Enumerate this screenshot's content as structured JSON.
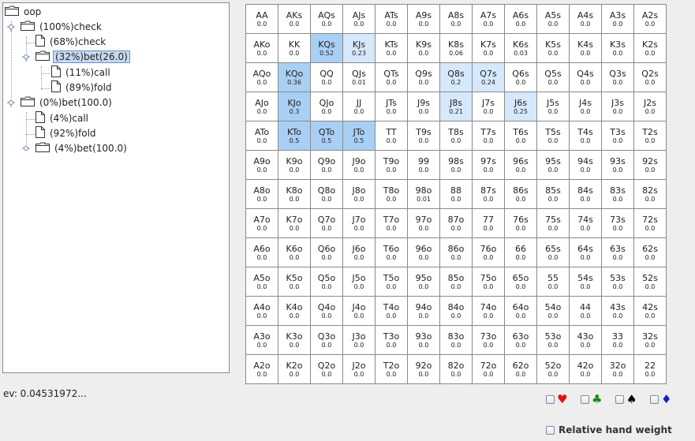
{
  "tree": {
    "root": "oop",
    "nodes": [
      {
        "label": "(100%)check"
      },
      {
        "label": "(68%)check"
      },
      {
        "label": "(32%)bet(26.0)"
      },
      {
        "label": "(11%)call"
      },
      {
        "label": "(89%)fold"
      },
      {
        "label": "(0%)bet(100.0)"
      },
      {
        "label": "(4%)call"
      },
      {
        "label": "(92%)fold"
      },
      {
        "label": "(4%)bet(100.0)"
      }
    ]
  },
  "matrix": {
    "highlight_color": "#a9cff5",
    "light_color": "#d6e8fb",
    "rows": [
      [
        [
          "AA",
          "0.0"
        ],
        [
          "AKs",
          "0.0"
        ],
        [
          "AQs",
          "0.0"
        ],
        [
          "AJs",
          "0.0"
        ],
        [
          "ATs",
          "0.0"
        ],
        [
          "A9s",
          "0.0"
        ],
        [
          "A8s",
          "0.0"
        ],
        [
          "A7s",
          "0.0"
        ],
        [
          "A6s",
          "0.0"
        ],
        [
          "A5s",
          "0.0"
        ],
        [
          "A4s",
          "0.0"
        ],
        [
          "A3s",
          "0.0"
        ],
        [
          "A2s",
          "0.0"
        ]
      ],
      [
        [
          "AKo",
          "0.0"
        ],
        [
          "KK",
          "0.0"
        ],
        [
          "KQs",
          "0.52"
        ],
        [
          "KJs",
          "0.23"
        ],
        [
          "KTs",
          "0.0"
        ],
        [
          "K9s",
          "0.0"
        ],
        [
          "K8s",
          "0.06"
        ],
        [
          "K7s",
          "0.0"
        ],
        [
          "K6s",
          "0.03"
        ],
        [
          "K5s",
          "0.0"
        ],
        [
          "K4s",
          "0.0"
        ],
        [
          "K3s",
          "0.0"
        ],
        [
          "K2s",
          "0.0"
        ]
      ],
      [
        [
          "AQo",
          "0.0"
        ],
        [
          "KQo",
          "0.36"
        ],
        [
          "QQ",
          "0.0"
        ],
        [
          "QJs",
          "0.01"
        ],
        [
          "QTs",
          "0.0"
        ],
        [
          "Q9s",
          "0.0"
        ],
        [
          "Q8s",
          "0.2"
        ],
        [
          "Q7s",
          "0.24"
        ],
        [
          "Q6s",
          "0.0"
        ],
        [
          "Q5s",
          "0.0"
        ],
        [
          "Q4s",
          "0.0"
        ],
        [
          "Q3s",
          "0.0"
        ],
        [
          "Q2s",
          "0.0"
        ]
      ],
      [
        [
          "AJo",
          "0.0"
        ],
        [
          "KJo",
          "0.3"
        ],
        [
          "QJo",
          "0.0"
        ],
        [
          "JJ",
          "0.0"
        ],
        [
          "JTs",
          "0.0"
        ],
        [
          "J9s",
          "0.0"
        ],
        [
          "J8s",
          "0.21"
        ],
        [
          "J7s",
          "0.0"
        ],
        [
          "J6s",
          "0.25"
        ],
        [
          "J5s",
          "0.0"
        ],
        [
          "J4s",
          "0.0"
        ],
        [
          "J3s",
          "0.0"
        ],
        [
          "J2s",
          "0.0"
        ]
      ],
      [
        [
          "ATo",
          "0.0"
        ],
        [
          "KTo",
          "0.5"
        ],
        [
          "QTo",
          "0.5"
        ],
        [
          "JTo",
          "0.5"
        ],
        [
          "TT",
          "0.0"
        ],
        [
          "T9s",
          "0.0"
        ],
        [
          "T8s",
          "0.0"
        ],
        [
          "T7s",
          "0.0"
        ],
        [
          "T6s",
          "0.0"
        ],
        [
          "T5s",
          "0.0"
        ],
        [
          "T4s",
          "0.0"
        ],
        [
          "T3s",
          "0.0"
        ],
        [
          "T2s",
          "0.0"
        ]
      ],
      [
        [
          "A9o",
          "0.0"
        ],
        [
          "K9o",
          "0.0"
        ],
        [
          "Q9o",
          "0.0"
        ],
        [
          "J9o",
          "0.0"
        ],
        [
          "T9o",
          "0.0"
        ],
        [
          "99",
          "0.0"
        ],
        [
          "98s",
          "0.0"
        ],
        [
          "97s",
          "0.0"
        ],
        [
          "96s",
          "0.0"
        ],
        [
          "95s",
          "0.0"
        ],
        [
          "94s",
          "0.0"
        ],
        [
          "93s",
          "0.0"
        ],
        [
          "92s",
          "0.0"
        ]
      ],
      [
        [
          "A8o",
          "0.0"
        ],
        [
          "K8o",
          "0.0"
        ],
        [
          "Q8o",
          "0.0"
        ],
        [
          "J8o",
          "0.0"
        ],
        [
          "T8o",
          "0.0"
        ],
        [
          "98o",
          "0.01"
        ],
        [
          "88",
          "0.0"
        ],
        [
          "87s",
          "0.0"
        ],
        [
          "86s",
          "0.0"
        ],
        [
          "85s",
          "0.0"
        ],
        [
          "84s",
          "0.0"
        ],
        [
          "83s",
          "0.0"
        ],
        [
          "82s",
          "0.0"
        ]
      ],
      [
        [
          "A7o",
          "0.0"
        ],
        [
          "K7o",
          "0.0"
        ],
        [
          "Q7o",
          "0.0"
        ],
        [
          "J7o",
          "0.0"
        ],
        [
          "T7o",
          "0.0"
        ],
        [
          "97o",
          "0.0"
        ],
        [
          "87o",
          "0.0"
        ],
        [
          "77",
          "0.0"
        ],
        [
          "76s",
          "0.0"
        ],
        [
          "75s",
          "0.0"
        ],
        [
          "74s",
          "0.0"
        ],
        [
          "73s",
          "0.0"
        ],
        [
          "72s",
          "0.0"
        ]
      ],
      [
        [
          "A6o",
          "0.0"
        ],
        [
          "K6o",
          "0.0"
        ],
        [
          "Q6o",
          "0.0"
        ],
        [
          "J6o",
          "0.0"
        ],
        [
          "T6o",
          "0.0"
        ],
        [
          "96o",
          "0.0"
        ],
        [
          "86o",
          "0.0"
        ],
        [
          "76o",
          "0.0"
        ],
        [
          "66",
          "0.0"
        ],
        [
          "65s",
          "0.0"
        ],
        [
          "64s",
          "0.0"
        ],
        [
          "63s",
          "0.0"
        ],
        [
          "62s",
          "0.0"
        ]
      ],
      [
        [
          "A5o",
          "0.0"
        ],
        [
          "K5o",
          "0.0"
        ],
        [
          "Q5o",
          "0.0"
        ],
        [
          "J5o",
          "0.0"
        ],
        [
          "T5o",
          "0.0"
        ],
        [
          "95o",
          "0.0"
        ],
        [
          "85o",
          "0.0"
        ],
        [
          "75o",
          "0.0"
        ],
        [
          "65o",
          "0.0"
        ],
        [
          "55",
          "0.0"
        ],
        [
          "54s",
          "0.0"
        ],
        [
          "53s",
          "0.0"
        ],
        [
          "52s",
          "0.0"
        ]
      ],
      [
        [
          "A4o",
          "0.0"
        ],
        [
          "K4o",
          "0.0"
        ],
        [
          "Q4o",
          "0.0"
        ],
        [
          "J4o",
          "0.0"
        ],
        [
          "T4o",
          "0.0"
        ],
        [
          "94o",
          "0.0"
        ],
        [
          "84o",
          "0.0"
        ],
        [
          "74o",
          "0.0"
        ],
        [
          "64o",
          "0.0"
        ],
        [
          "54o",
          "0.0"
        ],
        [
          "44",
          "0.0"
        ],
        [
          "43s",
          "0.0"
        ],
        [
          "42s",
          "0.0"
        ]
      ],
      [
        [
          "A3o",
          "0.0"
        ],
        [
          "K3o",
          "0.0"
        ],
        [
          "Q3o",
          "0.0"
        ],
        [
          "J3o",
          "0.0"
        ],
        [
          "T3o",
          "0.0"
        ],
        [
          "93o",
          "0.0"
        ],
        [
          "83o",
          "0.0"
        ],
        [
          "73o",
          "0.0"
        ],
        [
          "63o",
          "0.0"
        ],
        [
          "53o",
          "0.0"
        ],
        [
          "43o",
          "0.0"
        ],
        [
          "33",
          "0.0"
        ],
        [
          "32s",
          "0.0"
        ]
      ],
      [
        [
          "A2o",
          "0.0"
        ],
        [
          "K2o",
          "0.0"
        ],
        [
          "Q2o",
          "0.0"
        ],
        [
          "J2o",
          "0.0"
        ],
        [
          "T2o",
          "0.0"
        ],
        [
          "92o",
          "0.0"
        ],
        [
          "82o",
          "0.0"
        ],
        [
          "72o",
          "0.0"
        ],
        [
          "62o",
          "0.0"
        ],
        [
          "52o",
          "0.0"
        ],
        [
          "42o",
          "0.0"
        ],
        [
          "32o",
          "0.0"
        ],
        [
          "22",
          "0.0"
        ]
      ]
    ]
  },
  "ev": "ev: 0.04531972...",
  "suits": [
    {
      "name": "hearts-icon",
      "symbol": "♥",
      "color": "#e01010"
    },
    {
      "name": "clubs-icon",
      "symbol": "♣",
      "color": "#1a8a1a"
    },
    {
      "name": "spades-icon",
      "symbol": "♠",
      "color": "#000000"
    },
    {
      "name": "diamonds-icon",
      "symbol": "♦",
      "color": "#1020d0"
    }
  ],
  "relative_hand_weight": "Relative hand weight"
}
